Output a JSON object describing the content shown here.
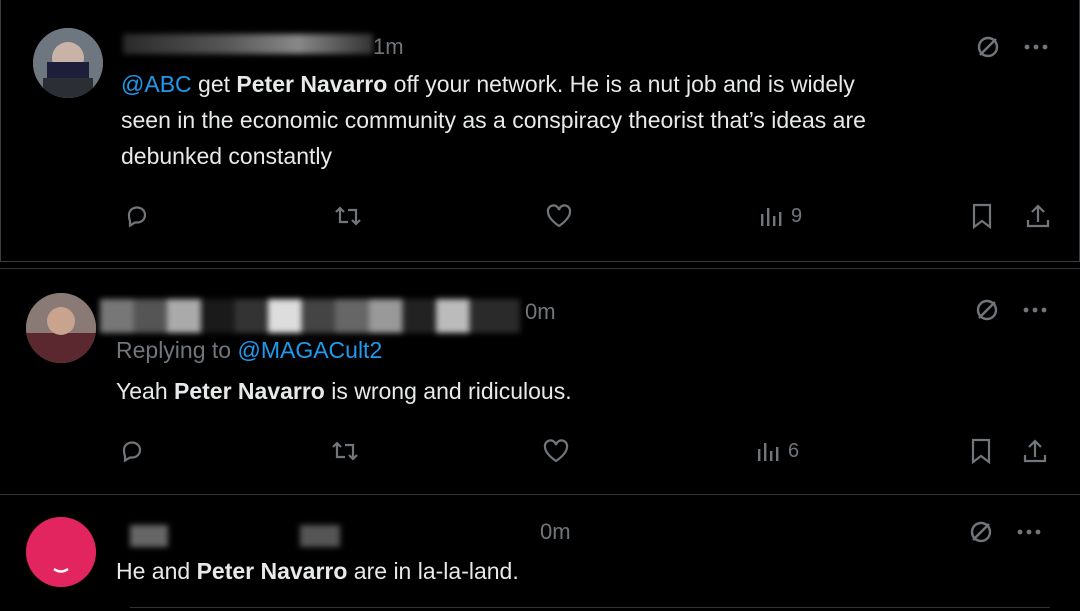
{
  "tweets": [
    {
      "time": "1m",
      "mention": "@ABC",
      "text_parts": [
        " get ",
        "Peter Navarro",
        " off your network. He is a nut job and is widely",
        "seen in the economic community as a conspiracy theorist that’s ideas are",
        "debunked constantly"
      ],
      "views": "9"
    },
    {
      "time": "0m",
      "replying_prefix": "Replying to ",
      "replying_handle": "@MAGACult2",
      "text_parts": [
        "Yeah ",
        "Peter Navarro",
        " is wrong and ridiculous."
      ],
      "views": "6"
    },
    {
      "time": "0m",
      "text_parts": [
        "He and ",
        "Peter Navarro",
        " are in la-la-land."
      ]
    }
  ],
  "icons": {
    "reply": "reply-icon",
    "retweet": "retweet-icon",
    "like": "like-icon",
    "views": "views-icon",
    "bookmark": "bookmark-icon",
    "share": "share-icon",
    "grok": "grok-icon",
    "more": "more-icon"
  }
}
